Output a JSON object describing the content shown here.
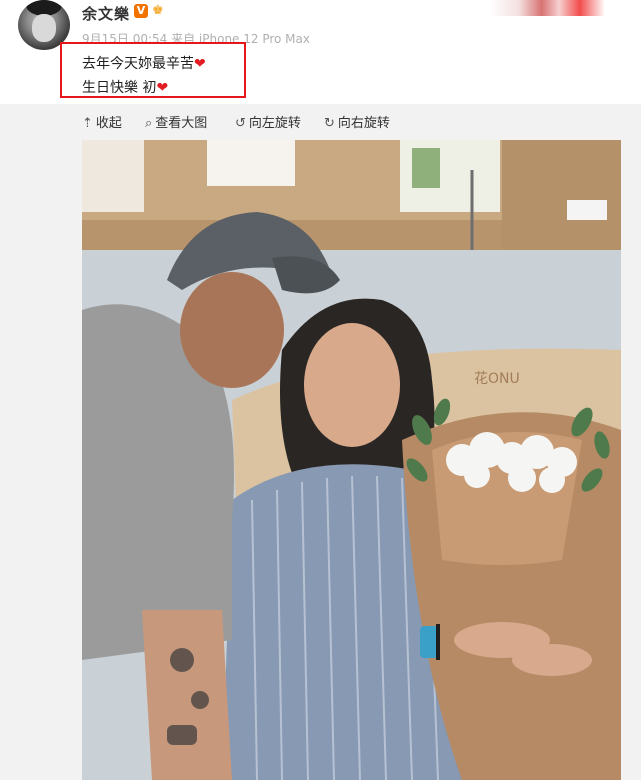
{
  "post": {
    "username": "余文樂",
    "vip_badge": "V",
    "crown_icon": "crown-icon",
    "meta": "9月15日 00:54 来自 iPhone 12 Pro Max",
    "text_line1": "去年今天妳最辛苦",
    "text_line2": "生日快樂 初",
    "heart_icon": "heart-icon",
    "highlight_color": "#e5171b"
  },
  "toolbar": {
    "collapse": "收起",
    "view_large": "查看大图",
    "rotate_left": "向左旋转",
    "rotate_right": "向右旋转"
  },
  "photo": {
    "bouquet_tag": "花ONU"
  }
}
